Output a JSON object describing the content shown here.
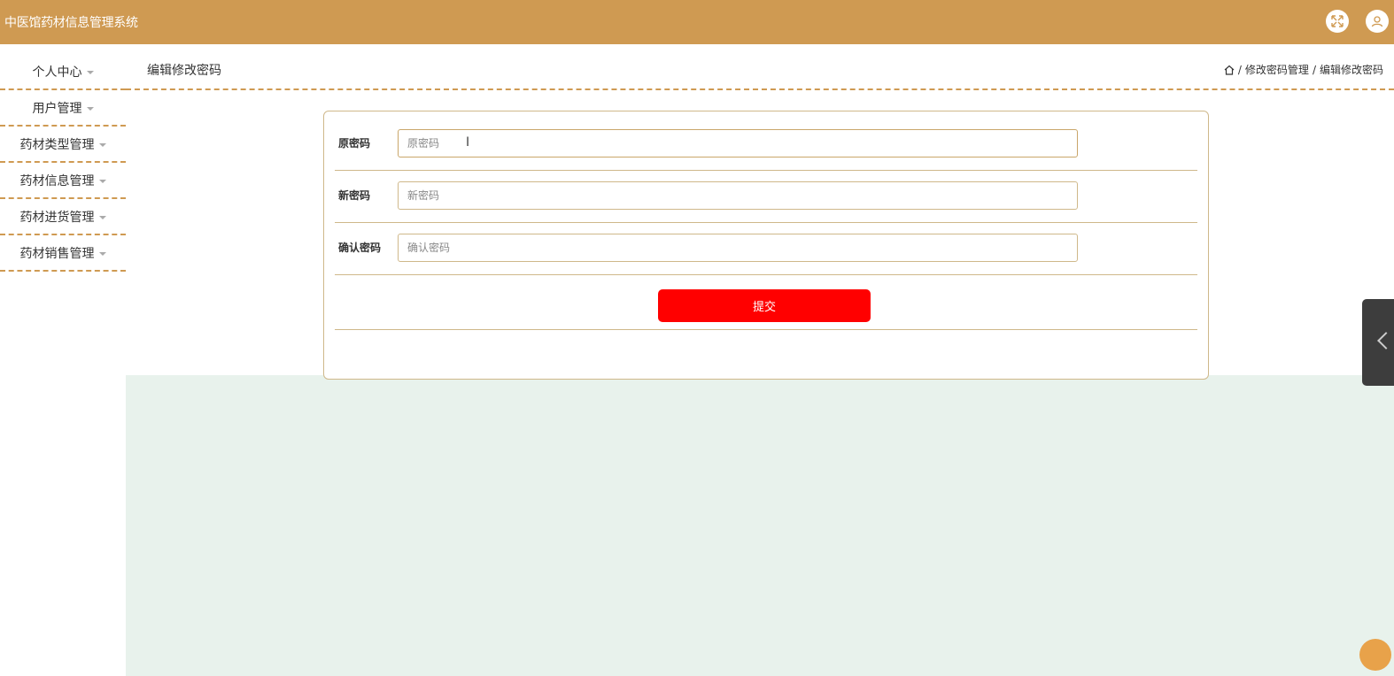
{
  "app": {
    "title": "中医馆药材信息管理系统"
  },
  "header": {
    "fullscreen_icon": "fullscreen-icon",
    "user_icon": "user-icon",
    "brand_color": "#cf9a52"
  },
  "sidebar": {
    "items": [
      {
        "label": "个人中心"
      },
      {
        "label": "用户管理"
      },
      {
        "label": "药材类型管理"
      },
      {
        "label": "药材信息管理"
      },
      {
        "label": "药材进货管理"
      },
      {
        "label": "药材销售管理"
      }
    ]
  },
  "page": {
    "title": "编辑修改密码",
    "breadcrumb": {
      "home_icon": "home-icon",
      "separator": "/",
      "items": [
        "修改密码管理",
        "编辑修改密码"
      ]
    }
  },
  "form": {
    "old_password": {
      "label": "原密码",
      "placeholder": "原密码",
      "value": ""
    },
    "new_password": {
      "label": "新密码",
      "placeholder": "新密码",
      "value": ""
    },
    "confirm_password": {
      "label": "确认密码",
      "placeholder": "确认密码",
      "value": ""
    },
    "submit_label": "提交",
    "submit_color": "#ff0000"
  }
}
